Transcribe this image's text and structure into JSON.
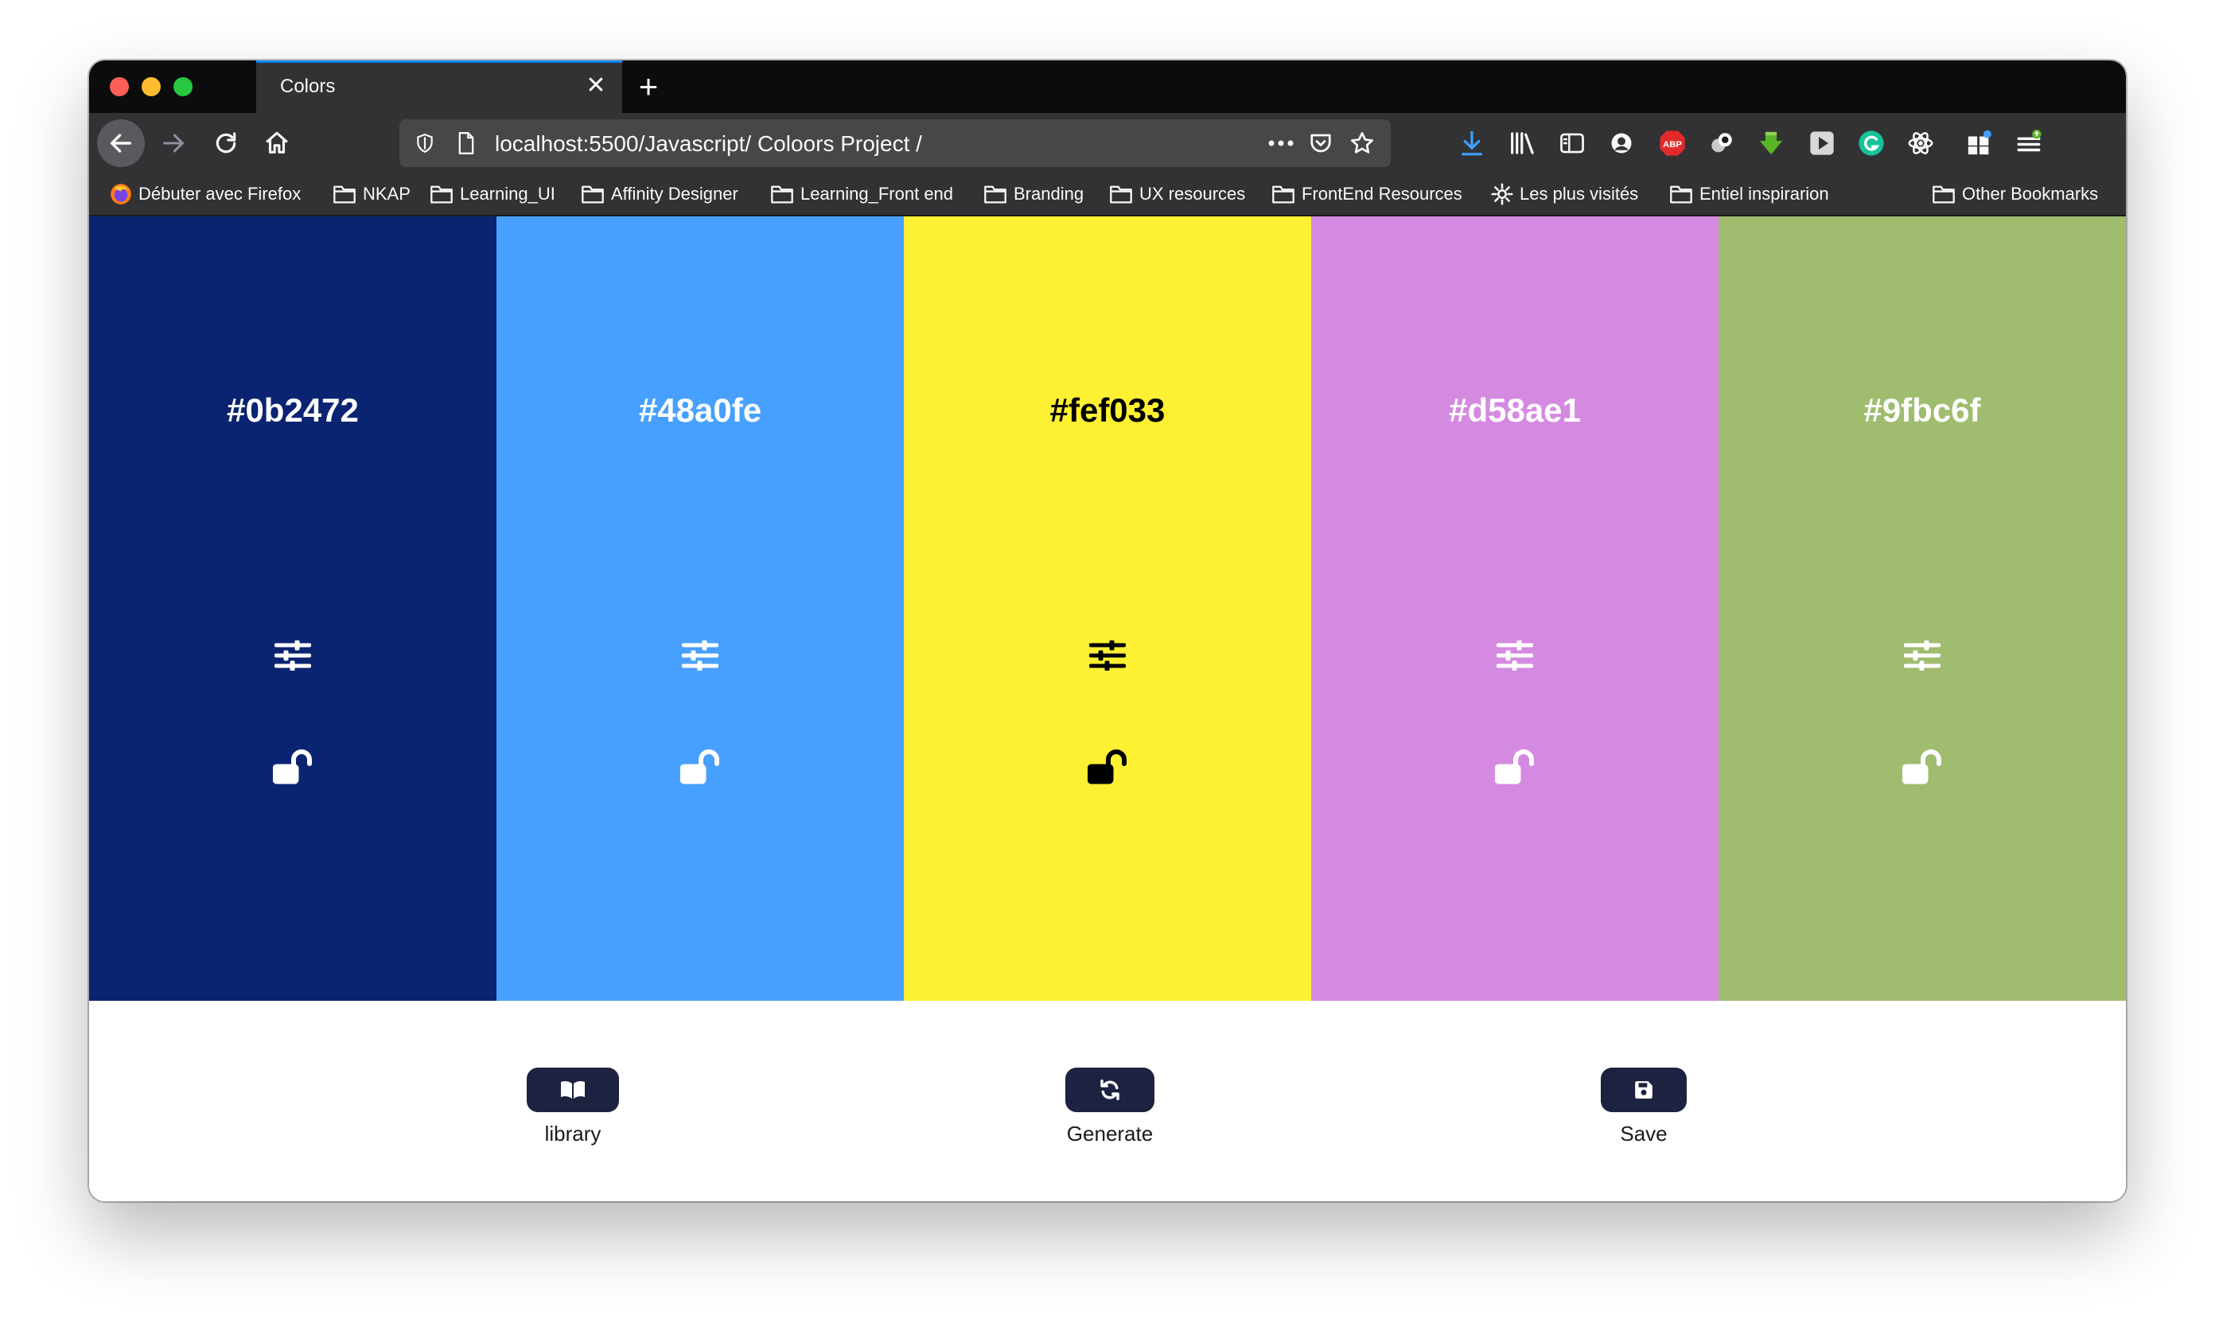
{
  "browser": {
    "tab": {
      "title": "Colors",
      "close_icon": "close-icon"
    },
    "new_tab_icon": "plus-icon",
    "url": "localhost:5500/Javascript/ Coloors Project /",
    "bookmarks": [
      {
        "label": "Débuter avec Firefox",
        "icon": "firefox-icon"
      },
      {
        "label": "NKAP",
        "icon": "folder-icon"
      },
      {
        "label": "Learning_UI",
        "icon": "folder-icon"
      },
      {
        "label": "Affinity Designer",
        "icon": "folder-icon"
      },
      {
        "label": "Learning_Front end",
        "icon": "folder-icon"
      },
      {
        "label": "Branding",
        "icon": "folder-icon"
      },
      {
        "label": "UX resources",
        "icon": "folder-icon"
      },
      {
        "label": "FrontEnd Resources",
        "icon": "folder-icon"
      },
      {
        "label": "Les plus visités",
        "icon": "gear-icon"
      },
      {
        "label": "Entiel inspirarion",
        "icon": "folder-icon"
      }
    ],
    "other_bookmarks": "Other Bookmarks",
    "colors": {
      "tabstrip": "#0c0c0d",
      "toolbar": "#323234",
      "active_tab_accent": "#0a84ff"
    }
  },
  "palette": [
    {
      "hex": "#0b2472",
      "text_color": "#ffffff"
    },
    {
      "hex": "#48a0fe",
      "text_color": "#ffffff"
    },
    {
      "hex": "#fef033",
      "text_color": "#000000"
    },
    {
      "hex": "#d58ae1",
      "text_color": "#ffffff"
    },
    {
      "hex": "#9fbc6f",
      "text_color": "#ffffff"
    }
  ],
  "controls": {
    "library": {
      "label": "library",
      "icon": "book-icon"
    },
    "generate": {
      "label": "Generate",
      "icon": "refresh-icon"
    },
    "save": {
      "label": "Save",
      "icon": "save-icon"
    },
    "button_color": "#1d2240"
  }
}
